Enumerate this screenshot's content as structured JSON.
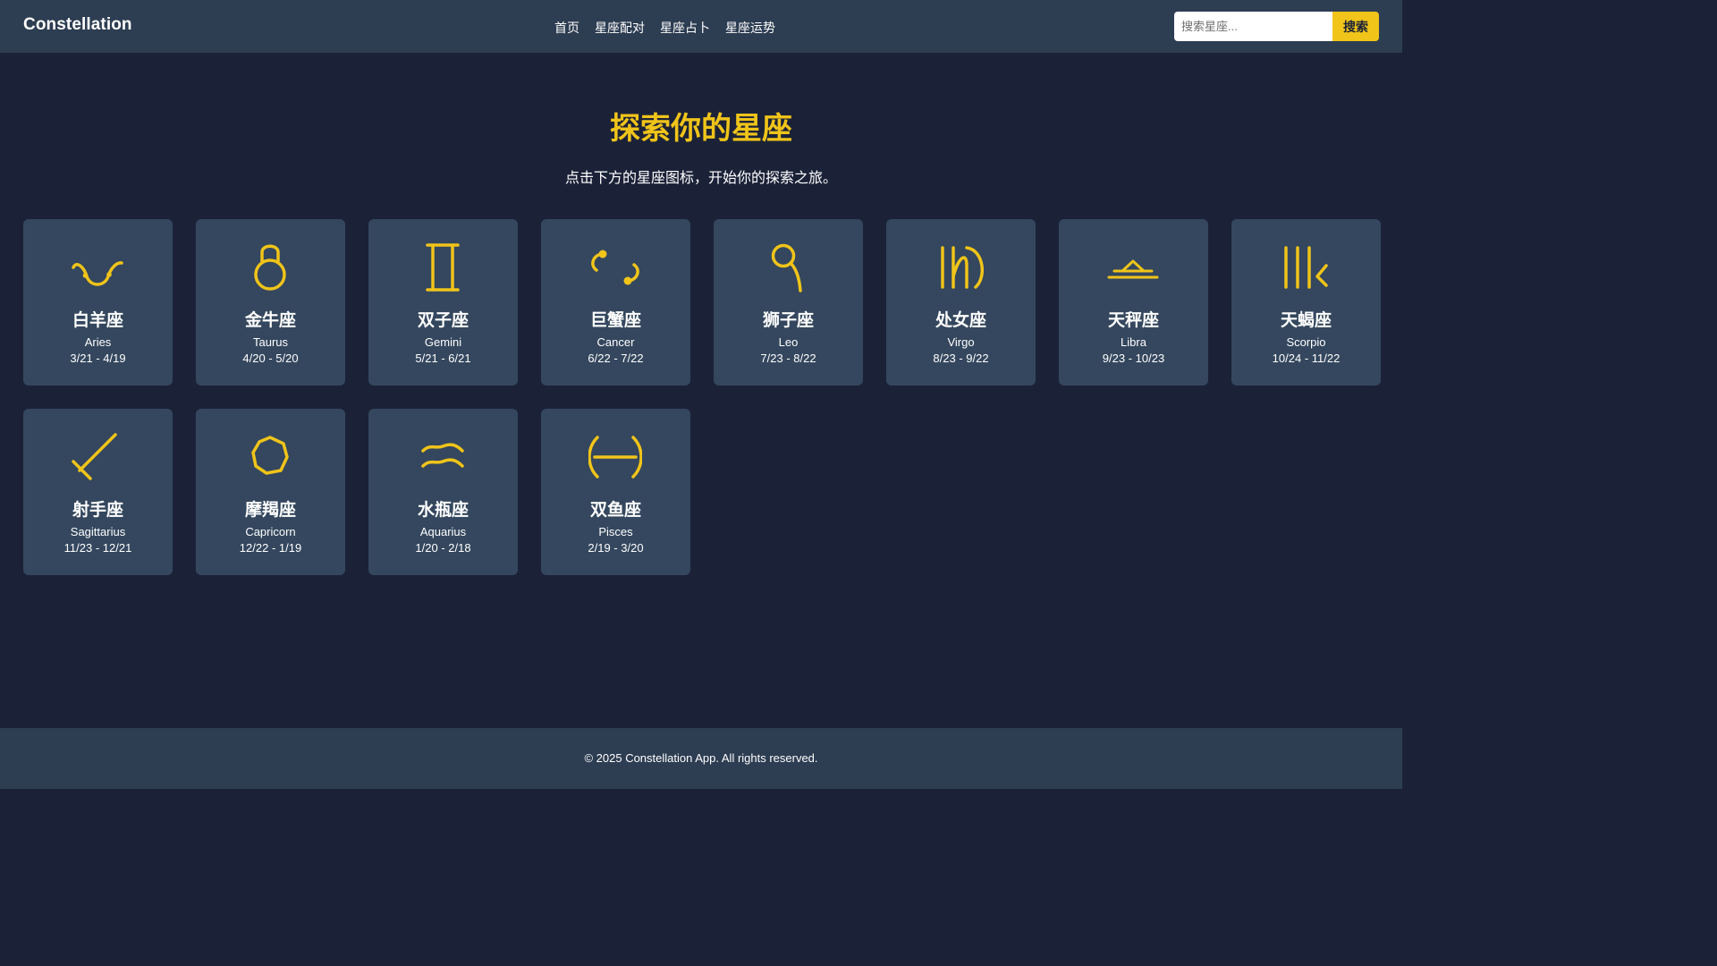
{
  "header": {
    "brand": "Constellation",
    "nav": [
      "首页",
      "星座配对",
      "星座占卜",
      "星座运势"
    ],
    "search_placeholder": "搜索星座...",
    "search_button": "搜索"
  },
  "hero": {
    "title": "探索你的星座",
    "subtitle": "点击下方的星座图标，开始你的探索之旅。"
  },
  "accent_color": "#f0c419",
  "signs": [
    {
      "cn": "白羊座",
      "en": "Aries",
      "dates": "3/21 - 4/19",
      "icon": "aries-icon"
    },
    {
      "cn": "金牛座",
      "en": "Taurus",
      "dates": "4/20 - 5/20",
      "icon": "taurus-icon"
    },
    {
      "cn": "双子座",
      "en": "Gemini",
      "dates": "5/21 - 6/21",
      "icon": "gemini-icon"
    },
    {
      "cn": "巨蟹座",
      "en": "Cancer",
      "dates": "6/22 - 7/22",
      "icon": "cancer-icon"
    },
    {
      "cn": "狮子座",
      "en": "Leo",
      "dates": "7/23 - 8/22",
      "icon": "leo-icon"
    },
    {
      "cn": "处女座",
      "en": "Virgo",
      "dates": "8/23 - 9/22",
      "icon": "virgo-icon"
    },
    {
      "cn": "天秤座",
      "en": "Libra",
      "dates": "9/23 - 10/23",
      "icon": "libra-icon"
    },
    {
      "cn": "天蝎座",
      "en": "Scorpio",
      "dates": "10/24 - 11/22",
      "icon": "scorpio-icon"
    },
    {
      "cn": "射手座",
      "en": "Sagittarius",
      "dates": "11/23 - 12/21",
      "icon": "sagittarius-icon"
    },
    {
      "cn": "摩羯座",
      "en": "Capricorn",
      "dates": "12/22 - 1/19",
      "icon": "capricorn-icon"
    },
    {
      "cn": "水瓶座",
      "en": "Aquarius",
      "dates": "1/20 - 2/18",
      "icon": "aquarius-icon"
    },
    {
      "cn": "双鱼座",
      "en": "Pisces",
      "dates": "2/19 - 3/20",
      "icon": "pisces-icon"
    }
  ],
  "footer": {
    "text": "© 2025 Constellation App. All rights reserved."
  }
}
